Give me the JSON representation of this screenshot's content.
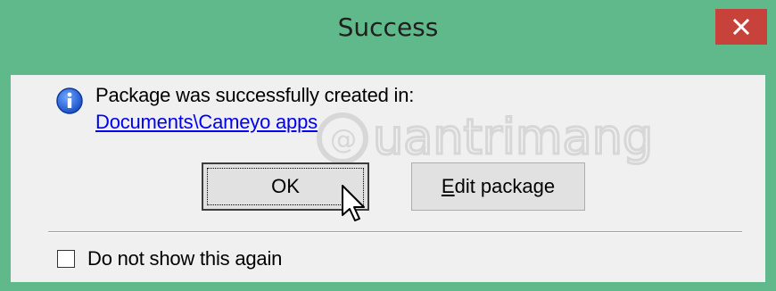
{
  "dialog": {
    "title": "Success",
    "message": "Package was successfully created in:",
    "path_link": "Documents\\Cameyo apps",
    "ok_label": "OK",
    "edit_label_accel": "E",
    "edit_label_rest": "dit package",
    "checkbox_label": "Do not show this again",
    "checkbox_checked": false
  },
  "icons": {
    "close": "close-icon",
    "info": "info-icon",
    "cursor": "mouse-pointer-icon"
  },
  "colors": {
    "frame": "#5fb98a",
    "close_button": "#c7423a",
    "link": "#0000ee"
  }
}
